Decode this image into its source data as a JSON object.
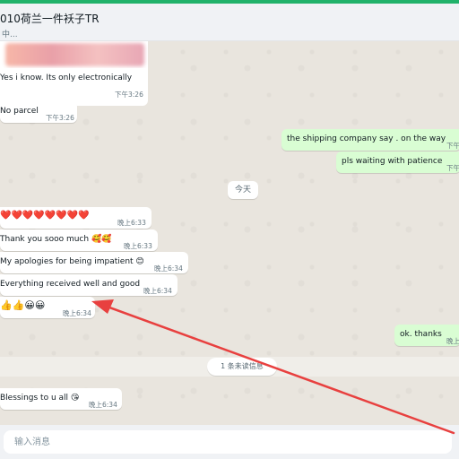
{
  "header": {
    "chat_name": "010荷兰一件袄子TR",
    "subtitle": "中..."
  },
  "messages": [
    {
      "text": "Yes i know. Its only electronically",
      "time": "下午3:26",
      "direction": "in"
    },
    {
      "text": "No parcel",
      "time": "下午3:26",
      "direction": "in"
    },
    {
      "text": "the shipping company say . on the way",
      "time": "下午",
      "direction": "out"
    },
    {
      "text": "pls waiting with patience",
      "time": "下午",
      "direction": "out"
    },
    {
      "text": "❤️❤️❤️❤️❤️❤️❤️❤️",
      "time": "晚上6:33",
      "direction": "in"
    },
    {
      "text": "Thank you sooo much 🥰🥰",
      "time": "晚上6:33",
      "direction": "in"
    },
    {
      "text": "My apologies for being impatient 😊",
      "time": "晚上6:34",
      "direction": "in"
    },
    {
      "text": "Everything received well and good",
      "time": "晚上6:34",
      "direction": "in"
    },
    {
      "text": "👍👍😀😀",
      "time": "晚上6:34",
      "direction": "in"
    },
    {
      "text": "ok. thanks",
      "time": "晚上",
      "direction": "out"
    },
    {
      "text": "Blessings to u all 😘",
      "time": "晚上6:34",
      "direction": "in"
    }
  ],
  "day_divider": "今天",
  "unread_divider": "1 条未读信息",
  "composer": {
    "placeholder": "输入消息"
  },
  "colors": {
    "accent": "#21b26a",
    "incoming_bubble": "#ffffff",
    "outgoing_bubble": "#d9fdd3",
    "chat_background": "#e9e5de",
    "annotation_arrow": "#e8403f"
  },
  "icons": [
    "red-arrow-annotation"
  ]
}
